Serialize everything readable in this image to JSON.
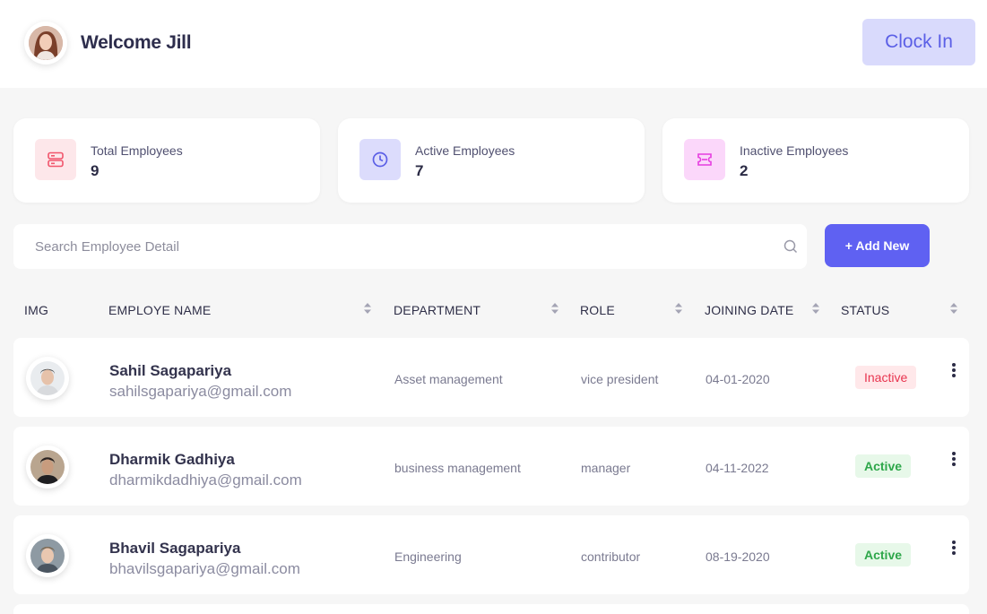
{
  "header": {
    "welcome": "Welcome Jill",
    "clock_in_label": "Clock In"
  },
  "stats": [
    {
      "label": "Total Employees",
      "value": "9",
      "icon": "server-icon",
      "bg": "#fde7ea",
      "color": "#f1556c"
    },
    {
      "label": "Active Employees",
      "value": "7",
      "icon": "clock-icon",
      "bg": "#dcdcfc",
      "color": "#5b5fe6"
    },
    {
      "label": "Inactive Employees",
      "value": "2",
      "icon": "ticket-icon",
      "bg": "#fbd7fa",
      "color": "#e63de0"
    }
  ],
  "search": {
    "placeholder": "Search Employee Detail"
  },
  "add_new_label": "+ Add New",
  "table": {
    "headers": [
      "IMG",
      "EMPLOYE NAME",
      "DEPARTMENT",
      "ROLE",
      "JOINING DATE",
      "STATUS"
    ],
    "rows": [
      {
        "name": "Sahil Sagapariya",
        "email": "sahilsgapariya@gmail.com",
        "department": "Asset management",
        "role": "vice president",
        "date": "04-01-2020",
        "status": "Inactive"
      },
      {
        "name": "Dharmik Gadhiya",
        "email": "dharmikdadhiya@gmail.com",
        "department": "business management",
        "role": "manager",
        "date": "04-11-2022",
        "status": "Active"
      },
      {
        "name": "Bhavil Sagapariya",
        "email": "bhavilsgapariya@gmail.com",
        "department": "Engineering",
        "role": "contributor",
        "date": "08-19-2020",
        "status": "Active"
      }
    ]
  },
  "colors": {
    "accent": "#5f61f2",
    "active": "#2ea74a",
    "inactive": "#e8344f"
  }
}
